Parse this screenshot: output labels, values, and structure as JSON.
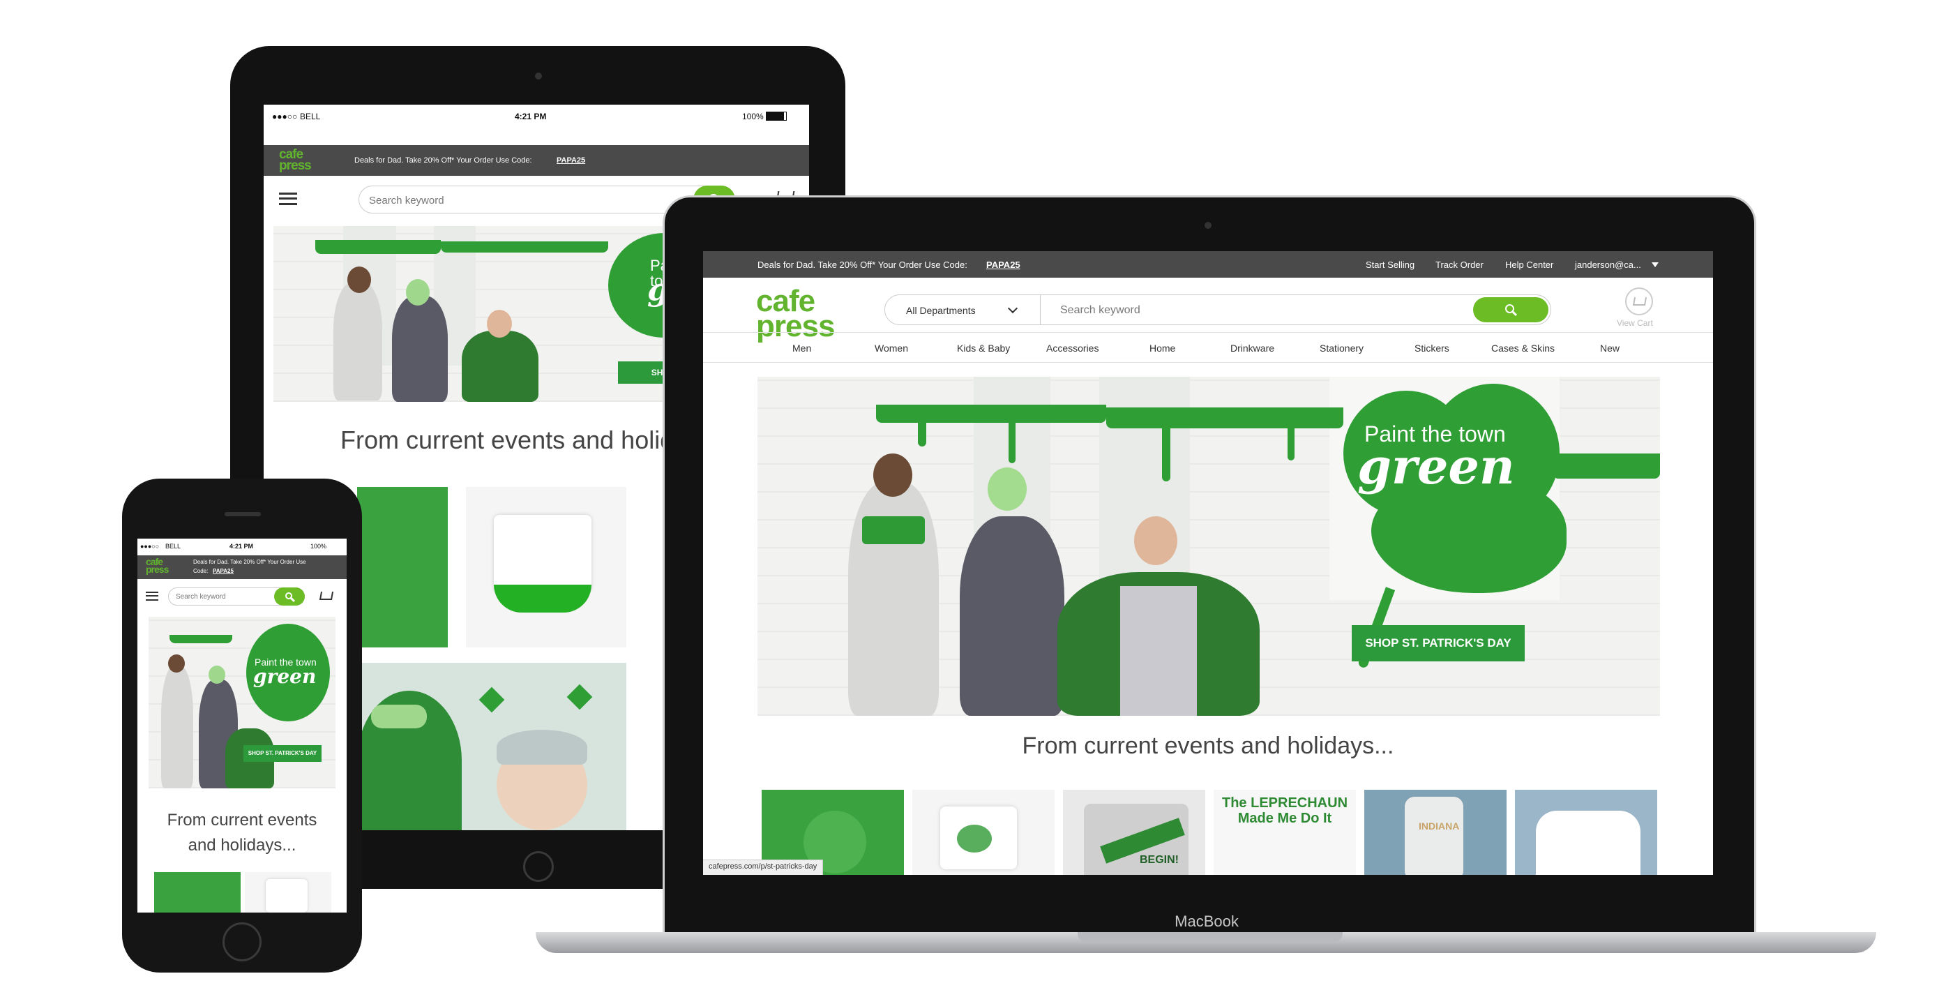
{
  "colors": {
    "brand_green": "#6cbc26",
    "hero_green": "#2f9e35",
    "top_bar": "#4a4a4a",
    "device_black": "#121212"
  },
  "macbook": {
    "label": "MacBook",
    "promo": {
      "text": "Deals for Dad. Take 20% Off* Your Order Use Code:",
      "code": "PAPA25"
    },
    "top_links": [
      "Start Selling",
      "Track Order",
      "Help Center"
    ],
    "account": {
      "label": "janderson@ca...",
      "icon": "caret-down-icon"
    },
    "logo": {
      "line1": "cafe",
      "line2": "press"
    },
    "search": {
      "department": "All Departments",
      "placeholder": "Search keyword",
      "button_icon": "search-icon"
    },
    "cart": {
      "label": "View Cart",
      "icon": "cart-icon"
    },
    "nav": [
      "Men",
      "Women",
      "Kids & Baby",
      "Accessories",
      "Home",
      "Drinkware",
      "Stationery",
      "Stickers",
      "Cases & Skins",
      "New"
    ],
    "hero": {
      "line1": "Paint the town",
      "line2": "green",
      "cta": "SHOP ST. PATRICK'S DAY"
    },
    "heading": "From current events and holidays...",
    "tiles": [
      {
        "caption": ""
      },
      {
        "caption": ""
      },
      {
        "caption": "BEGIN!"
      },
      {
        "caption": "The LEPRECHAUN Made Me Do It"
      },
      {
        "caption": "INDIANA"
      },
      {
        "caption": ""
      }
    ],
    "status_url": "cafepress.com/p/st-patricks-day"
  },
  "tablet": {
    "status": {
      "carrier": "BELL",
      "time": "4:21 PM",
      "battery": "100%"
    },
    "promo": {
      "text": "Deals for Dad. Take 20% Off* Your Order Use Code:",
      "code": "PAPA25"
    },
    "logo": {
      "line1": "cafe",
      "line2": "press"
    },
    "search": {
      "placeholder": "Search keyword"
    },
    "hero": {
      "line1": "Paint the town",
      "line2": "green",
      "cta": "SHOP ST."
    },
    "heading": "From current events and holid"
  },
  "phone": {
    "status": {
      "carrier": "BELL",
      "time": "4:21 PM",
      "battery": "100%"
    },
    "promo": {
      "text": "Deals for Dad. Take 20% Off* Your Order Use",
      "code_prefix": "Code:",
      "code": "PAPA25"
    },
    "logo": {
      "line1": "cafe",
      "line2": "press"
    },
    "search": {
      "placeholder": "Search keyword"
    },
    "hero": {
      "line1": "Paint the town",
      "line2": "green",
      "cta": "SHOP ST. PATRICK'S DAY"
    },
    "heading_line1": "From current events",
    "heading_line2": "and holidays..."
  }
}
